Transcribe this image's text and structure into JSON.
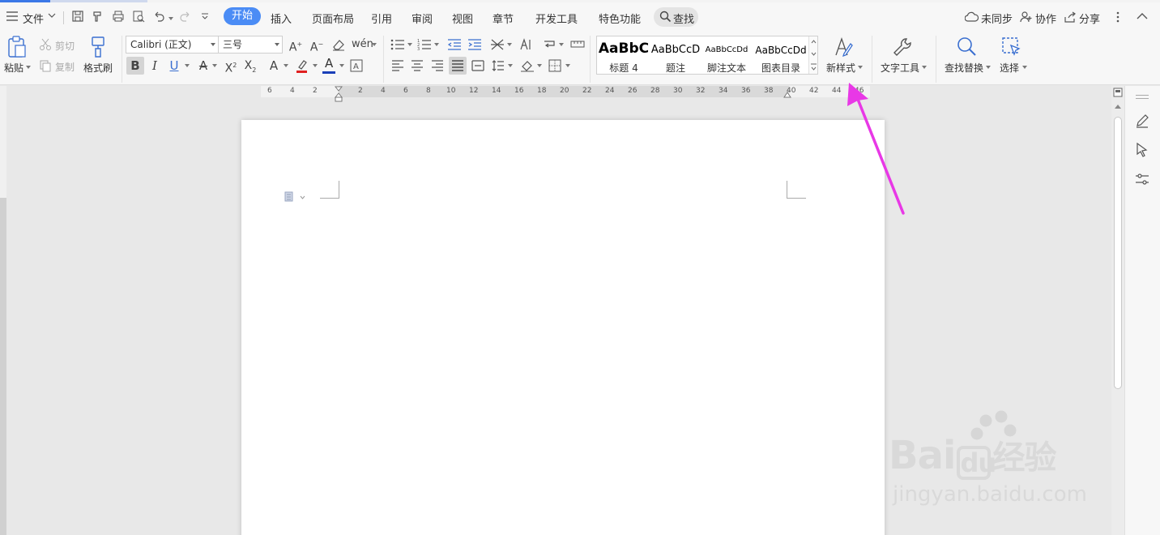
{
  "menubar": {
    "file": "文件",
    "tabs": [
      "开始",
      "插入",
      "页面布局",
      "引用",
      "审阅",
      "视图",
      "章节",
      "开发工具",
      "特色功能"
    ],
    "active_tab": "开始",
    "search": "查找",
    "not_synced": "未同步",
    "collaborate": "协作",
    "share": "分享"
  },
  "ribbon": {
    "paste": "粘贴",
    "cut": "剪切",
    "copy": "复制",
    "format_painter": "格式刷",
    "font_name": "Calibri (正文)",
    "font_size": "三号",
    "styles": [
      {
        "preview": "AaBbC",
        "name": "标题 4"
      },
      {
        "preview": "AaBbCcD",
        "name": "题注"
      },
      {
        "preview": "AaBbCcDd",
        "name": "脚注文本"
      },
      {
        "preview": "AaBbCcDd",
        "name": "图表目录"
      }
    ],
    "new_style": "新样式",
    "text_tools": "文字工具",
    "find_replace": "查找替换",
    "select": "选择"
  },
  "ruler": {
    "left_numbers": [
      "6",
      "4",
      "2"
    ],
    "right_numbers": [
      "2",
      "4",
      "6",
      "8",
      "10",
      "12",
      "14",
      "16",
      "18",
      "20",
      "22",
      "24",
      "26",
      "28",
      "30",
      "32",
      "34",
      "36",
      "38",
      "40",
      "42",
      "44",
      "46"
    ]
  },
  "watermark": {
    "brand": "Bai",
    "brand2": "du",
    "suffix": "经验",
    "url": "jingyan.baidu.com"
  },
  "colors": {
    "accent": "#4b8cf5",
    "arrow": "#e838e6",
    "font_color_red": "#e02020",
    "font_color_blue": "#1a3fb8"
  }
}
